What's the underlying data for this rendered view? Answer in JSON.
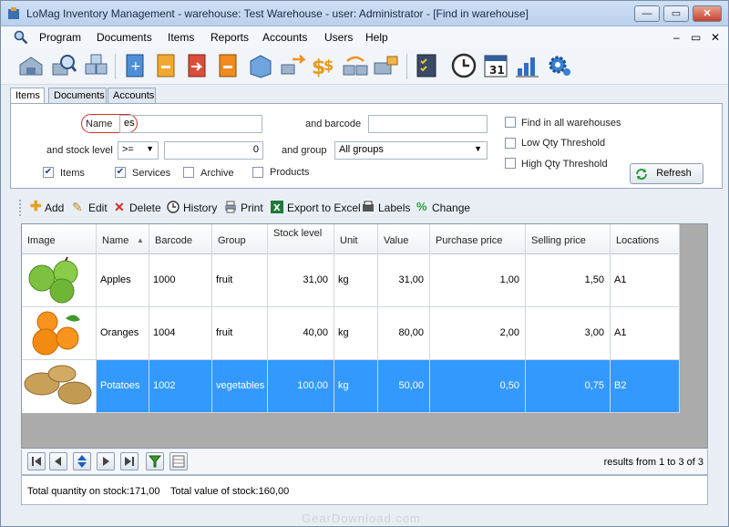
{
  "window": {
    "title": "LoMag Inventory Management - warehouse: Test Warehouse - user: Administrator - [Find in warehouse]"
  },
  "menu": [
    "Program",
    "Documents",
    "Items",
    "Reports",
    "Accounts",
    "Users",
    "Help"
  ],
  "tabs": [
    "Items",
    "Documents",
    "Accounts"
  ],
  "search": {
    "name_label": "Name",
    "name_value": "es",
    "barcode_label": "and barcode",
    "barcode_value": "",
    "stock_label": "and stock level",
    "stock_op": ">=",
    "stock_value": "0",
    "group_label": "and group",
    "group_value": "All groups",
    "chk_items": "Items",
    "chk_services": "Services",
    "chk_archive": "Archive",
    "chk_products": "Products",
    "opt_all_wh": "Find in all warehouses",
    "opt_low": "Low Qty Threshold",
    "opt_high": "High Qty Threshold",
    "refresh": "Refresh"
  },
  "actions": {
    "add": "Add",
    "edit": "Edit",
    "delete": "Delete",
    "history": "History",
    "print": "Print",
    "export": "Export to Excel",
    "labels": "Labels",
    "change": "Change"
  },
  "columns": [
    "Image",
    "Name",
    "Barcode",
    "Group",
    "Stock level",
    "Unit",
    "Value",
    "Purchase price",
    "Selling price",
    "Locations"
  ],
  "rows": [
    {
      "name": "Apples",
      "barcode": "1000",
      "group": "fruit",
      "stock": "31,00",
      "unit": "kg",
      "value": "31,00",
      "purchase": "1,00",
      "selling": "1,50",
      "location": "A1"
    },
    {
      "name": "Oranges",
      "barcode": "1004",
      "group": "fruit",
      "stock": "40,00",
      "unit": "kg",
      "value": "80,00",
      "purchase": "2,00",
      "selling": "3,00",
      "location": "A1"
    },
    {
      "name": "Potatoes",
      "barcode": "1002",
      "group": "vegetables",
      "stock": "100,00",
      "unit": "kg",
      "value": "50,00",
      "purchase": "0,50",
      "selling": "0,75",
      "location": "B2"
    }
  ],
  "results": "results from 1 to 3 of 3",
  "status": {
    "total_qty": "Total quantity on stock:171,00",
    "total_value": "Total value of stock:160,00"
  },
  "watermark": "GearDownload.com",
  "colors": {
    "selection": "#3399ff",
    "title_bar": "#c3d6ee",
    "close_button": "#c8442c"
  }
}
